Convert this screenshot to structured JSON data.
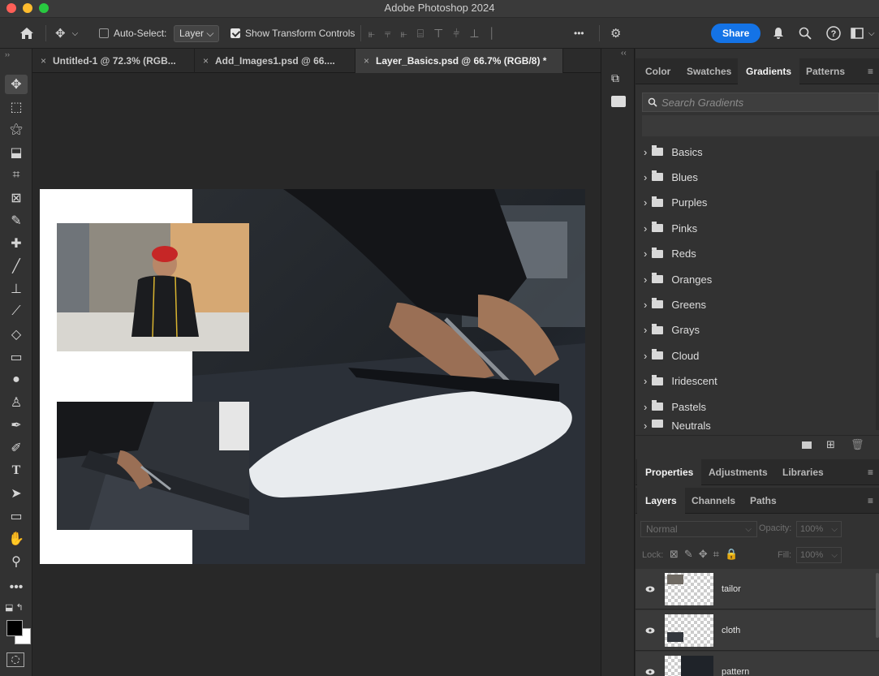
{
  "app": {
    "title": "Adobe Photoshop 2024"
  },
  "options_bar": {
    "auto_select_label": "Auto-Select:",
    "auto_select_value": "Layer",
    "show_transform_label": "Show Transform Controls",
    "more": "•••",
    "share": "Share"
  },
  "tabs": [
    {
      "label": "Untitled-1 @ 72.3% (RGB..."
    },
    {
      "label": "Add_Images1.psd @ 66...."
    },
    {
      "label": "Layer_Basics.psd @ 66.7% (RGB/8) *"
    }
  ],
  "gradients_panel": {
    "tabs": [
      "Color",
      "Swatches",
      "Gradients",
      "Patterns"
    ],
    "active_tab": "Gradients",
    "search_placeholder": "Search Gradients",
    "folders": [
      "Basics",
      "Blues",
      "Purples",
      "Pinks",
      "Reds",
      "Oranges",
      "Greens",
      "Grays",
      "Cloud",
      "Iridescent",
      "Pastels",
      "Neutrals"
    ]
  },
  "properties_panel": {
    "tabs": [
      "Properties",
      "Adjustments",
      "Libraries"
    ]
  },
  "layers_panel": {
    "tabs": [
      "Layers",
      "Channels",
      "Paths"
    ],
    "blend_mode": "Normal",
    "opacity_label": "Opacity:",
    "opacity_value": "100%",
    "lock_label": "Lock:",
    "fill_label": "Fill:",
    "fill_value": "100%",
    "layers": [
      {
        "name": "tailor",
        "visible": true
      },
      {
        "name": "cloth",
        "visible": true
      },
      {
        "name": "pattern",
        "visible": true
      }
    ]
  },
  "colors": {
    "accent": "#1473e6",
    "panel": "#323232",
    "canvas_bg": "#282828"
  }
}
